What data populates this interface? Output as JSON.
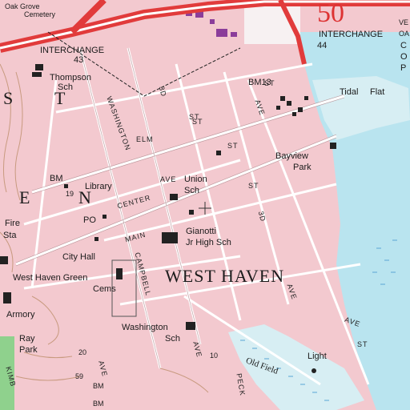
{
  "map": {
    "colors": {
      "urban": "#f3c9cf",
      "water": "#b9e4ef",
      "road_red": "#e13b3b",
      "road_white": "#ffffff",
      "grid": "#b8969a",
      "contour": "#c89a7f",
      "building": "#222222",
      "purple": "#8b3d9a",
      "marsh": "#5aa6d6",
      "green": "#8fd18d",
      "gray": "#d9d9d9"
    },
    "labels": {
      "oak_grove": "Oak Grove",
      "cemetery": "Cemetery",
      "interchange43": "INTERCHANGE",
      "interchange43_num": "43",
      "interchange44": "INTERCHANGE",
      "interchange44_num": "44",
      "thompson": "Thompson",
      "thompson_sch": "Sch",
      "bm13": "BM13",
      "tidal": "Tidal",
      "flat": "Flat",
      "bayview": "Bayview",
      "park": "Park",
      "union": "Union",
      "union_sch": "Sch",
      "library": "Library",
      "bm_19": "BM",
      "num_19": "19",
      "fire": "Fire",
      "sta": "Sta",
      "po": "PO",
      "city_hall": "City Hall",
      "gianotti": "Gianotti",
      "jr_high": "Jr High Sch",
      "west_haven_green": "West Haven Green",
      "cems": "Cems",
      "west_haven": "WEST HAVEN",
      "armory": "Armory",
      "washington": "Washington",
      "washington_sch": "Sch",
      "old_field": "Old Field",
      "light": "Light",
      "ray": "Ray",
      "park2": "Park",
      "bm_bottom": "BM",
      "num_59": "59",
      "num_10": "10",
      "num_20": "20",
      "big_s": "S",
      "big_t": "T",
      "big_e": "E",
      "big_n": "N",
      "red_50": "50",
      "c": "C",
      "o": "O",
      "p": "P",
      "ve": "VE",
      "oa": "OA"
    },
    "streets": {
      "washington_st": "WASHINGTON",
      "elm": "ELM",
      "st_elm": "ST",
      "center": "CENTER",
      "main": "MAIN",
      "campbell": "CAMPBELL",
      "third": "3D",
      "third_b": "3D",
      "ave1": "AVE",
      "ave2": "AVE",
      "ave3": "AVE",
      "ave4": "AVE",
      "ave5": "AVE",
      "ave6": "AVE",
      "st1": "ST",
      "st2": "ST",
      "st3": "ST",
      "st4": "ST",
      "st5": "ST",
      "peck": "PECK",
      "kimberly": "KIMB",
      "bm_trail": "BM"
    }
  }
}
